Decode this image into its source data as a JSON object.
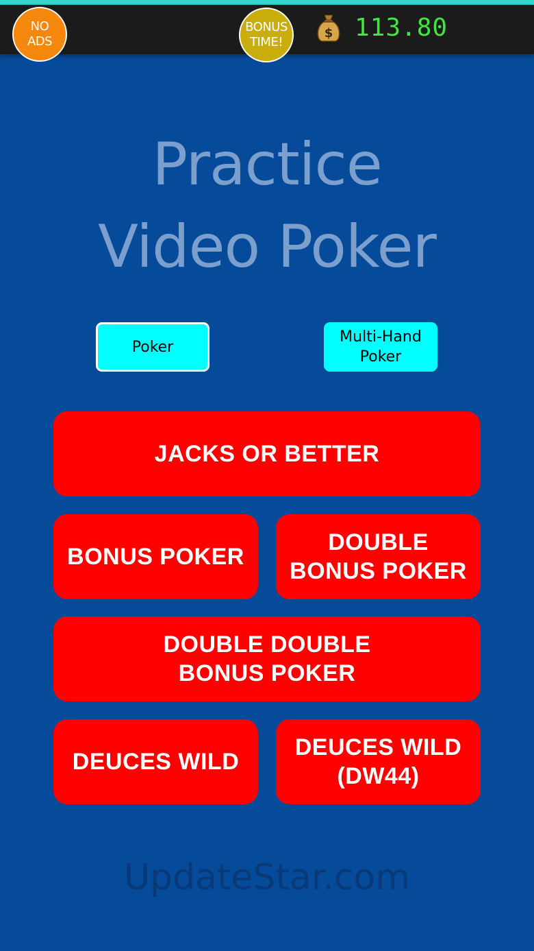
{
  "header": {
    "no_ads_label": "NO\nADS",
    "bonus_time_label": "BONUS\nTIME!",
    "balance": "113.80",
    "money_icon": "money-bag-icon",
    "colors": {
      "no_ads": "#f5870c",
      "bonus_time": "#c8ad0c",
      "balance": "#3fe83f"
    }
  },
  "title": {
    "line1": "Practice",
    "line2": "Video Poker"
  },
  "modes": {
    "poker": "Poker",
    "multi_hand": "Multi-Hand\nPoker",
    "selected": "Poker"
  },
  "games": {
    "jacks_or_better": "JACKS OR BETTER",
    "bonus_poker": "BONUS POKER",
    "double_bonus_poker": "DOUBLE\nBONUS POKER",
    "double_double_bonus_poker": "DOUBLE DOUBLE\nBONUS POKER",
    "deuces_wild": "DEUCES WILD",
    "deuces_wild_dw44": "DEUCES WILD\n(DW44)"
  },
  "watermark": "UpdateStar.com",
  "colors": {
    "background": "#054b9a",
    "game_button": "#ff0000",
    "mode_button": "#00ffff"
  }
}
